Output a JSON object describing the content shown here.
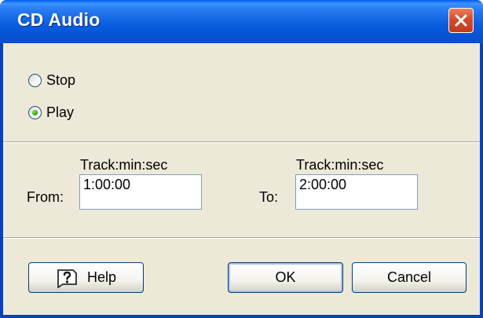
{
  "window": {
    "title": "CD Audio"
  },
  "mode": {
    "options": [
      {
        "label": "Stop",
        "selected": false
      },
      {
        "label": "Play",
        "selected": true
      }
    ]
  },
  "range": {
    "format_label": "Track:min:sec",
    "from_label": "From:",
    "from_value": "1:00:00",
    "to_label": "To:",
    "to_value": "2:00:00"
  },
  "buttons": {
    "help": "Help",
    "ok": "OK",
    "cancel": "Cancel"
  },
  "icons": {
    "close": "close-icon",
    "help": "help-icon"
  },
  "colors": {
    "titlebar": "#0a5fe0",
    "dialog_background": "#ece9d8",
    "close_button": "#d54b2a",
    "radio_selected": "#2ea30f"
  }
}
